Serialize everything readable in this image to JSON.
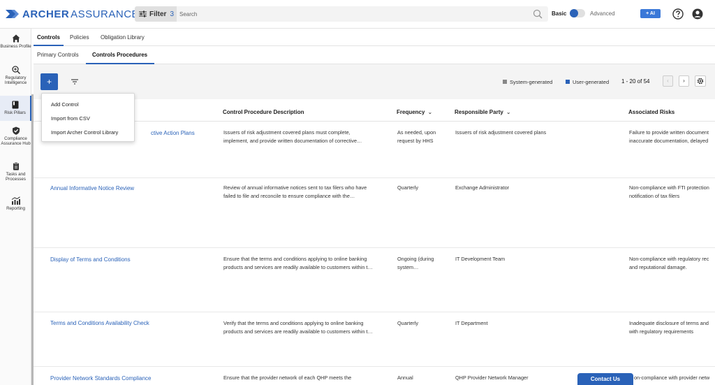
{
  "brand": {
    "name_bold": "ARCHER",
    "name_light": "ASSURANCE AI",
    "color": "#2a62b8"
  },
  "topbar": {
    "filter_label": "Filter",
    "filter_count": "3",
    "search_placeholder": "Search",
    "basic_label": "Basic",
    "advanced_label": "Advanced",
    "ai_label": "+ AI"
  },
  "sidenav": [
    {
      "label": "Business Profile",
      "icon": "home-icon"
    },
    {
      "label": "Regulatory Intelligence",
      "icon": "magnify-plus-icon"
    },
    {
      "label": "Risk Pillars",
      "icon": "book-icon",
      "active": true
    },
    {
      "label": "Compliance Assurance Hub",
      "icon": "shield-check-icon"
    },
    {
      "label": "Tasks and Processes",
      "icon": "clipboard-icon"
    },
    {
      "label": "Reporting",
      "icon": "chart-icon"
    }
  ],
  "tabs": [
    "Controls",
    "Policies",
    "Obligation Library"
  ],
  "subtabs": [
    "Primary Controls",
    "Controls Procedures"
  ],
  "toolbar": {
    "add_label": "+",
    "legend_system": "System-generated",
    "legend_user": "User-generated",
    "paging": "1 - 20 of 54",
    "prev": "‹",
    "next": "›"
  },
  "add_menu": [
    "Add Control",
    "Import from CSV",
    "Import Archer Control Library"
  ],
  "columns": {
    "description": "Control Procedure Description",
    "frequency": "Frequency",
    "responsible": "Responsible Party",
    "risks": "Associated Risks"
  },
  "rows": [
    {
      "name": "ctive Action Plans",
      "desc1": "Issuers of risk adjustment covered plans must complete,",
      "desc2": "implement, and provide written documentation of corrective…",
      "freq1": "As needed, upon",
      "freq2": "request by HHS",
      "party": "Issuers of risk adjustment covered plans",
      "risk1": "Failure to provide written document",
      "risk2": "inaccurate documentation, delayed"
    },
    {
      "name": "Annual Informative Notice Review",
      "desc1": "Review of annual informative notices sent to tax filers who have",
      "desc2": "failed to file and reconcile to ensure compliance with the…",
      "freq1": "Quarterly",
      "freq2": "",
      "party": "Exchange Administrator",
      "risk1": "Non-compliance with FTI protection",
      "risk2": "notification of tax filers"
    },
    {
      "name": "Display of Terms and Conditions",
      "desc1": "Ensure that the terms and conditions applying to online banking",
      "desc2": "products and services are readily available to customers within t…",
      "freq1": "Ongoing (during",
      "freq2": "system…",
      "party": "IT Development Team",
      "risk1": "Non-compliance with regulatory rec",
      "risk2": "and reputational damage."
    },
    {
      "name": "Terms and Conditions Availability Check",
      "desc1": "Verify that the terms and conditions applying to online banking",
      "desc2": "products and services are readily available to customers within t…",
      "freq1": "Quarterly",
      "freq2": "",
      "party": "IT Department",
      "risk1": "Inadequate disclosure of terms and",
      "risk2": "with regulatory requirements"
    },
    {
      "name": "Provider Network Standards Compliance",
      "desc1": "Ensure that the provider network of each QHP meets the",
      "desc2": "",
      "freq1": "Annual",
      "freq2": "",
      "party": "QHP Provider Network Manager",
      "risk1": "on-compliance with provider netw",
      "risk2": ""
    }
  ],
  "contact_label": "Contact Us"
}
